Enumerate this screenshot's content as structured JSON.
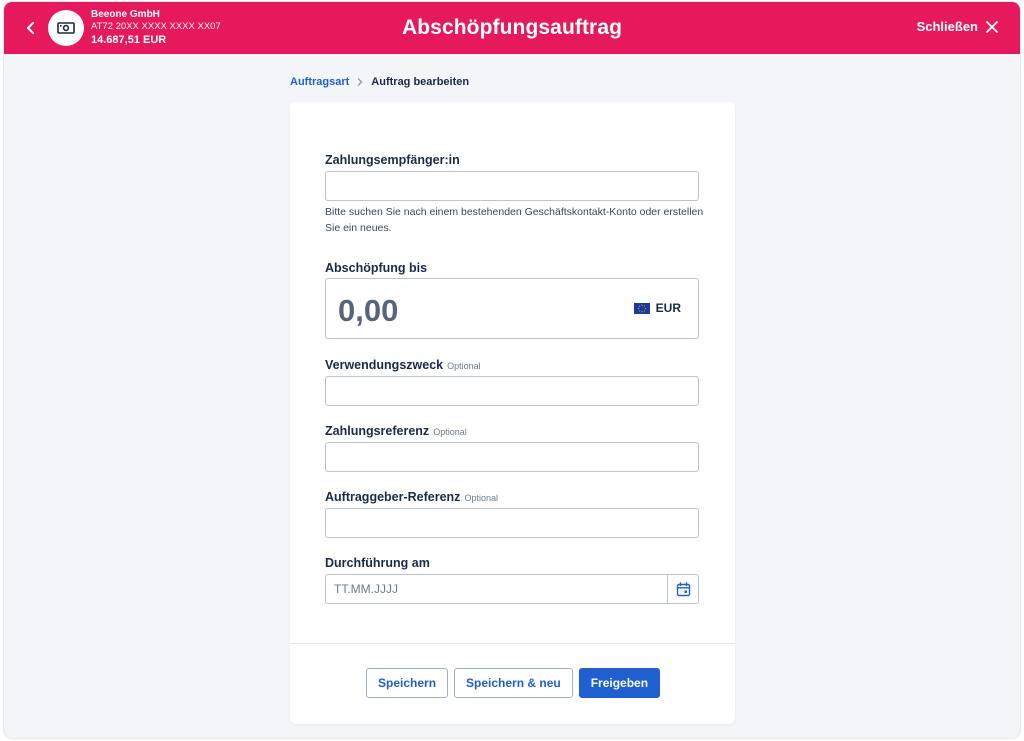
{
  "header": {
    "account_name": "Beeone GmbH",
    "account_iban": "AT72 20XX XXXX XXXX XX07",
    "account_balance": "14.687,51 EUR",
    "title": "Abschöpfungsauftrag",
    "close_label": "Schließen"
  },
  "breadcrumb": {
    "parent": "Auftragsart",
    "current": "Auftrag bearbeiten"
  },
  "form": {
    "payee": {
      "label": "Zahlungsempfänger:in",
      "value": "",
      "hint": "Bitte suchen Sie nach einem bestehenden Geschäftskontakt-Konto oder erstellen Sie ein neues."
    },
    "amount": {
      "label": "Abschöpfung bis",
      "value": "0,00",
      "currency": "EUR"
    },
    "purpose": {
      "label": "Verwendungszweck",
      "optional": "Optional",
      "value": ""
    },
    "payment_reference": {
      "label": "Zahlungsreferenz",
      "optional": "Optional",
      "value": ""
    },
    "ordering_reference": {
      "label": "Auftraggeber-Referenz",
      "optional": "Optional",
      "value": ""
    },
    "execution_date": {
      "label": "Durchführung am",
      "placeholder": "TT.MM.JJJJ",
      "value": ""
    }
  },
  "actions": {
    "save": "Speichern",
    "save_new": "Speichern & neu",
    "release": "Freigeben"
  },
  "colors": {
    "header_bg": "#e5195b",
    "primary": "#1f5fcf",
    "page_bg": "#f3f5f9",
    "text": "#1b2a4a"
  },
  "icons": {
    "back": "chevron-left-icon",
    "account": "banknote-icon",
    "close": "close-icon",
    "breadcrumb_sep": "chevron-right-icon",
    "currency": "eu-flag-icon",
    "calendar": "calendar-icon"
  }
}
